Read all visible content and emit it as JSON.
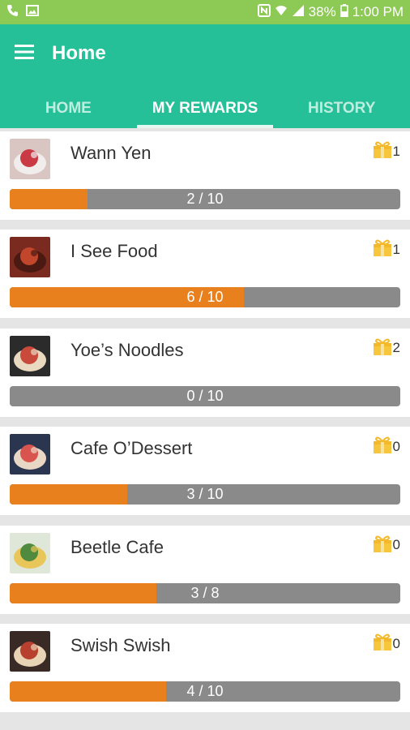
{
  "status_bar": {
    "battery": "38%",
    "time": "1:00 PM",
    "icons": [
      "phone-icon",
      "image-icon",
      "nfc-icon",
      "wifi-icon",
      "signal-icon",
      "battery-icon"
    ]
  },
  "app_bar": {
    "title": "Home",
    "menu_icon": "menu-icon"
  },
  "tabs": [
    {
      "label": "HOME",
      "active": false
    },
    {
      "label": "MY REWARDS",
      "active": true
    },
    {
      "label": "HISTORY",
      "active": false
    }
  ],
  "rewards": [
    {
      "name": "Wann Yen",
      "gift_count": "1",
      "progress_text": "2 / 10",
      "current": 2,
      "total": 10,
      "thumb_palette": [
        "#d9c6c2",
        "#c93a45",
        "#f2eded"
      ]
    },
    {
      "name": "I See Food",
      "gift_count": "1",
      "progress_text": "6 / 10",
      "current": 6,
      "total": 10,
      "thumb_palette": [
        "#7a2a1e",
        "#c2462b",
        "#4a1a12"
      ]
    },
    {
      "name": "Yoe’s Noodles",
      "gift_count": "2",
      "progress_text": "0 / 10",
      "current": 0,
      "total": 10,
      "thumb_palette": [
        "#2b2b2b",
        "#c94a3b",
        "#e8d9c0"
      ]
    },
    {
      "name": "Cafe O’Dessert",
      "gift_count": "0",
      "progress_text": "3 / 10",
      "current": 3,
      "total": 10,
      "thumb_palette": [
        "#2a3550",
        "#d9534f",
        "#e9d7c5"
      ]
    },
    {
      "name": "Beetle Cafe",
      "gift_count": "0",
      "progress_text": "3 / 8",
      "current": 3,
      "total": 8,
      "thumb_palette": [
        "#dfe7d8",
        "#4f8a3e",
        "#e8c65a"
      ]
    },
    {
      "name": "Swish Swish",
      "gift_count": "0",
      "progress_text": "4 / 10",
      "current": 4,
      "total": 10,
      "thumb_palette": [
        "#3a2a25",
        "#b7412e",
        "#e8d3b5"
      ]
    }
  ],
  "colors": {
    "status_bar": "#8dc955",
    "app_bar": "#25bf98",
    "progress_fill": "#e8801e",
    "progress_track": "#8a8a8a",
    "gift": "#f7c63c"
  }
}
